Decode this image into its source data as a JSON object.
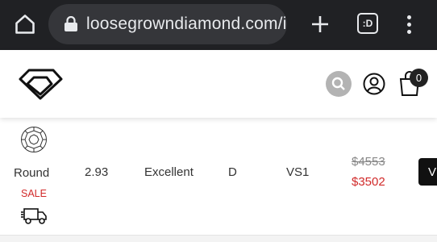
{
  "browser": {
    "url": "loosegrowndiamond.com/i",
    "tab_count": ":D"
  },
  "header": {
    "cart_count": "0"
  },
  "product": {
    "shape": "Round",
    "carat": "2.93",
    "cut": "Excellent",
    "color": "D",
    "clarity": "VS1",
    "original_price": "$4553",
    "sale_price": "$3502",
    "sale_label": "SALE",
    "view_label": "V"
  },
  "colors": {
    "sale_red": "#d12a2a",
    "chrome_bg": "#202124"
  }
}
